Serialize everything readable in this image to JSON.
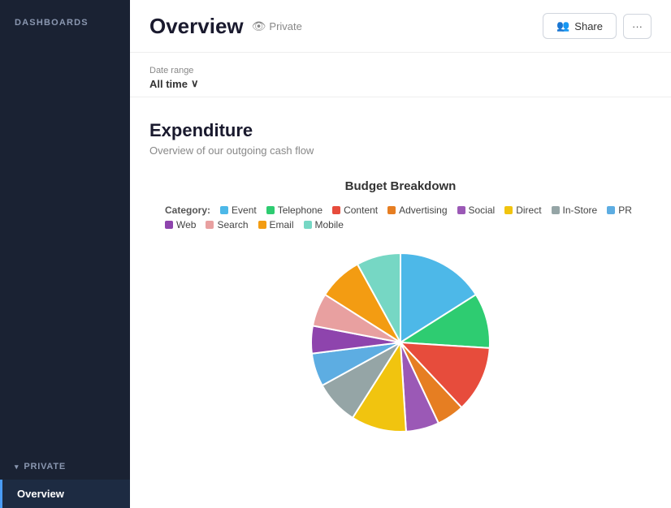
{
  "sidebar": {
    "header_label": "DASHBOARDS",
    "section_label": "PRIVATE",
    "nav_items": [
      {
        "label": "Overview",
        "active": true
      }
    ]
  },
  "header": {
    "title": "Overview",
    "private_label": "Private",
    "share_label": "Share",
    "more_label": "···"
  },
  "date_range": {
    "label": "Date range",
    "value": "All time"
  },
  "section": {
    "title": "Expenditure",
    "subtitle": "Overview of our outgoing cash flow"
  },
  "chart": {
    "title": "Budget Breakdown",
    "legend_label": "Category:",
    "categories": [
      {
        "name": "Event",
        "color": "#4db8e8"
      },
      {
        "name": "Telephone",
        "color": "#2ecc71"
      },
      {
        "name": "Content",
        "color": "#e74c3c"
      },
      {
        "name": "Advertising",
        "color": "#e67e22"
      },
      {
        "name": "Social",
        "color": "#9b59b6"
      },
      {
        "name": "Direct",
        "color": "#f1c40f"
      },
      {
        "name": "In-Store",
        "color": "#95a5a6"
      },
      {
        "name": "PR",
        "color": "#5dade2"
      },
      {
        "name": "Web",
        "color": "#8e44ad"
      },
      {
        "name": "Search",
        "color": "#e8a0a0"
      },
      {
        "name": "Email",
        "color": "#f39c12"
      },
      {
        "name": "Mobile",
        "color": "#76d7c4"
      }
    ],
    "slices": [
      {
        "category": "Event",
        "percent": 16,
        "color": "#4db8e8"
      },
      {
        "category": "Telephone",
        "percent": 10,
        "color": "#2ecc71"
      },
      {
        "category": "Content",
        "percent": 12,
        "color": "#e74c3c"
      },
      {
        "category": "Advertising",
        "percent": 5,
        "color": "#e67e22"
      },
      {
        "category": "Social",
        "percent": 6,
        "color": "#9b59b6"
      },
      {
        "category": "Direct",
        "percent": 10,
        "color": "#f1c40f"
      },
      {
        "category": "In-Store",
        "percent": 8,
        "color": "#95a5a6"
      },
      {
        "category": "PR",
        "percent": 6,
        "color": "#5dade2"
      },
      {
        "category": "Web",
        "percent": 5,
        "color": "#8e44ad"
      },
      {
        "category": "Search",
        "percent": 6,
        "color": "#e8a0a0"
      },
      {
        "category": "Email",
        "percent": 8,
        "color": "#f39c12"
      },
      {
        "category": "Mobile",
        "percent": 8,
        "color": "#76d7c4"
      }
    ]
  }
}
